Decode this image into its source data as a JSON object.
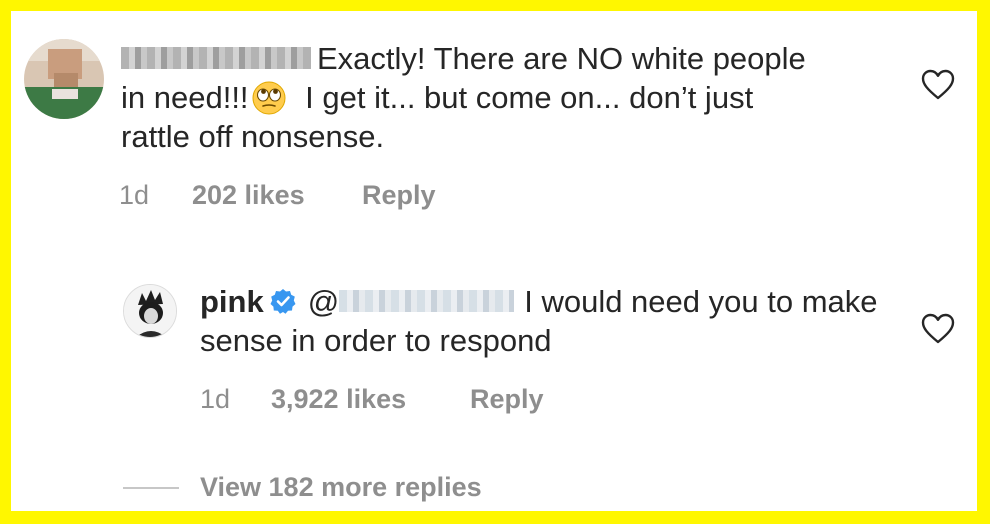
{
  "comments": [
    {
      "text_part1": "Exactly! There are NO white people in need!!!",
      "text_part2": " I get it... but come on... don’t just rattle off nonsense.",
      "time": "1d",
      "likes": "202 likes",
      "reply": "Reply",
      "emoji": "face-with-rolling-eyes"
    },
    {
      "username": "pink",
      "mention_prefix": "@",
      "text": "I would need you to make sense in order to respond",
      "time": "1d",
      "likes": "3,922 likes",
      "reply": "Reply",
      "verified": true
    }
  ],
  "view_replies": "View 182 more replies",
  "colors": {
    "frame": "#FFF700",
    "text": "#262626",
    "meta": "#8e8e8e",
    "verified": "#3897f0"
  },
  "icons": [
    "heart-icon",
    "verified-badge-icon",
    "rolling-eyes-emoji"
  ]
}
